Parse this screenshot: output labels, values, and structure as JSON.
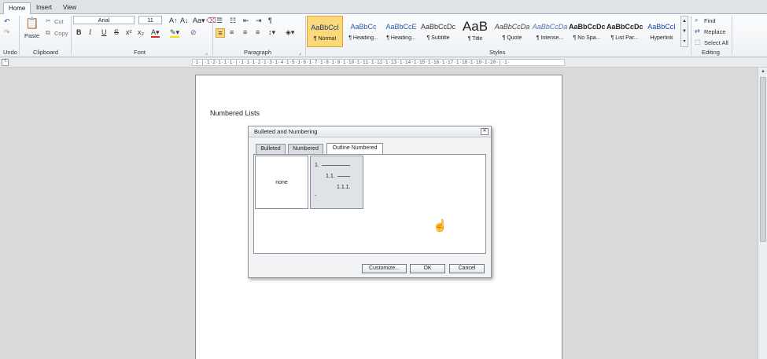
{
  "ribbon_tabs": [
    "Home",
    "Insert",
    "View"
  ],
  "active_tab": "Home",
  "groups": {
    "undo": {
      "label": "Undo"
    },
    "clipboard": {
      "label": "Clipboard",
      "paste": "Paste",
      "cut": "Cut",
      "copy": "Copy"
    },
    "font": {
      "label": "Font",
      "font_name": "Arial",
      "font_size": "11",
      "bold": "B",
      "italic": "I",
      "underline": "U",
      "strike": "S"
    },
    "paragraph": {
      "label": "Paragraph"
    },
    "styles": {
      "label": "Styles",
      "items": [
        {
          "sample": "AaBbCcI",
          "name": "¶ Normal",
          "selected": true,
          "color": "#1e3a6e"
        },
        {
          "sample": "AaBbCc",
          "name": "¶ Heading...",
          "selected": false,
          "color": "#2a5aa8"
        },
        {
          "sample": "AaBbCcE",
          "name": "¶ Heading...",
          "selected": false,
          "color": "#2a5aa8"
        },
        {
          "sample": "AaBbCcDc",
          "name": "¶ Subtitle",
          "selected": false,
          "color": "#333333"
        },
        {
          "sample": "AaB",
          "name": "¶ Title",
          "selected": false,
          "color": "#222222"
        },
        {
          "sample": "AaBbCcDa",
          "name": "¶ Quote",
          "selected": false,
          "color": "#444444"
        },
        {
          "sample": "AaBbCcDa",
          "name": "¶ Intense...",
          "selected": false,
          "color": "#4a74b0"
        },
        {
          "sample": "AaBbCcDc",
          "name": "¶ No Spa...",
          "selected": false,
          "color": "#222222"
        },
        {
          "sample": "AaBbCcDc",
          "name": "¶ List Par...",
          "selected": false,
          "color": "#222222"
        },
        {
          "sample": "AaBbCcI",
          "name": "Hyperlink",
          "selected": false,
          "color": "#1a3fa8"
        }
      ]
    },
    "editing": {
      "label": "Editing",
      "find": "Find",
      "replace": "Replace",
      "select_all": "Select All"
    }
  },
  "ruler_text": "·1·|·1·2·1·1·1·|·1·1·1·2·1·3·1·4·1·5·1·6·1·7·1·8·1·9·1·10·1·11·1·12·1·13·1·14·1·15·1·16·1·17·1·18·1·19·1·20·|·1·",
  "document": {
    "heading": "Numbered Lists"
  },
  "dialog": {
    "title": "Bulleted and Numbering",
    "close": "✕",
    "tabs": [
      "Bulleted",
      "Numbered",
      "Outline Numbered"
    ],
    "active_tab": "Outline Numbered",
    "option_none": "none",
    "outline": [
      "1.",
      "1.1.",
      "1.1.1.",
      "-"
    ],
    "buttons": {
      "customize": "Customize...",
      "ok": "OK",
      "cancel": "Cancel"
    }
  }
}
